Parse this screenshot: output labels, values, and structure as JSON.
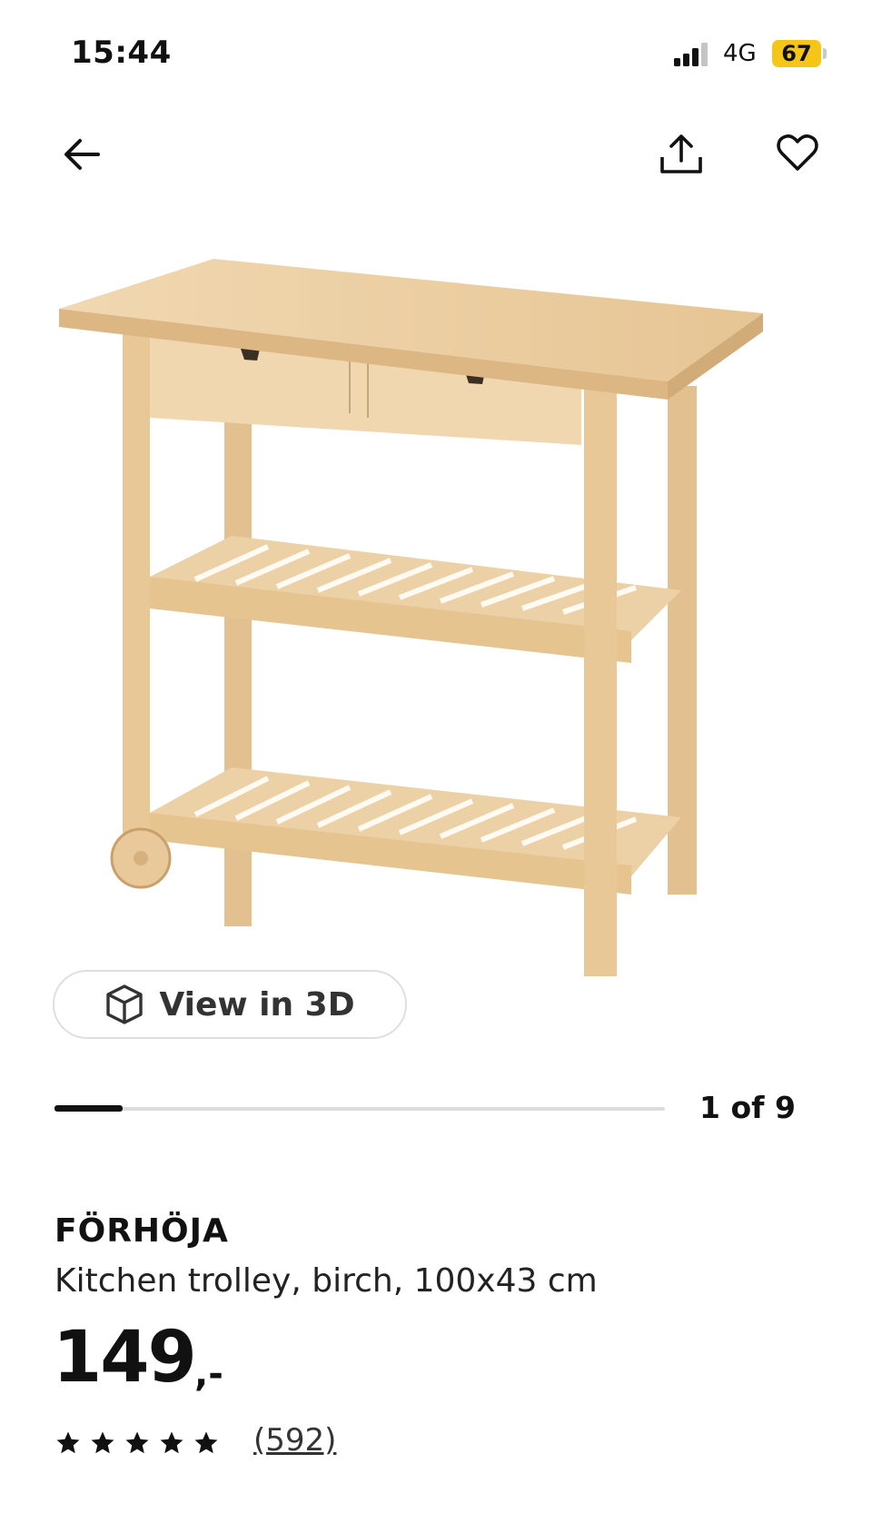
{
  "status_bar": {
    "time": "15:44",
    "network": "4G",
    "battery": "67",
    "battery_color": "#f5c518"
  },
  "nav": {
    "back_icon": "arrow-left-icon",
    "share_icon": "share-icon",
    "favorite_icon": "heart-icon"
  },
  "gallery": {
    "view_3d_label": "View in 3D",
    "view_3d_icon": "cube-icon",
    "counter": "1 of 9",
    "current_index": 1,
    "total_images": 9
  },
  "product": {
    "name": "FÖRHÖJA",
    "description": "Kitchen trolley, birch, 100x43 cm",
    "price": "149",
    "price_suffix": ",-",
    "rating": 5,
    "review_count": "(592)"
  }
}
